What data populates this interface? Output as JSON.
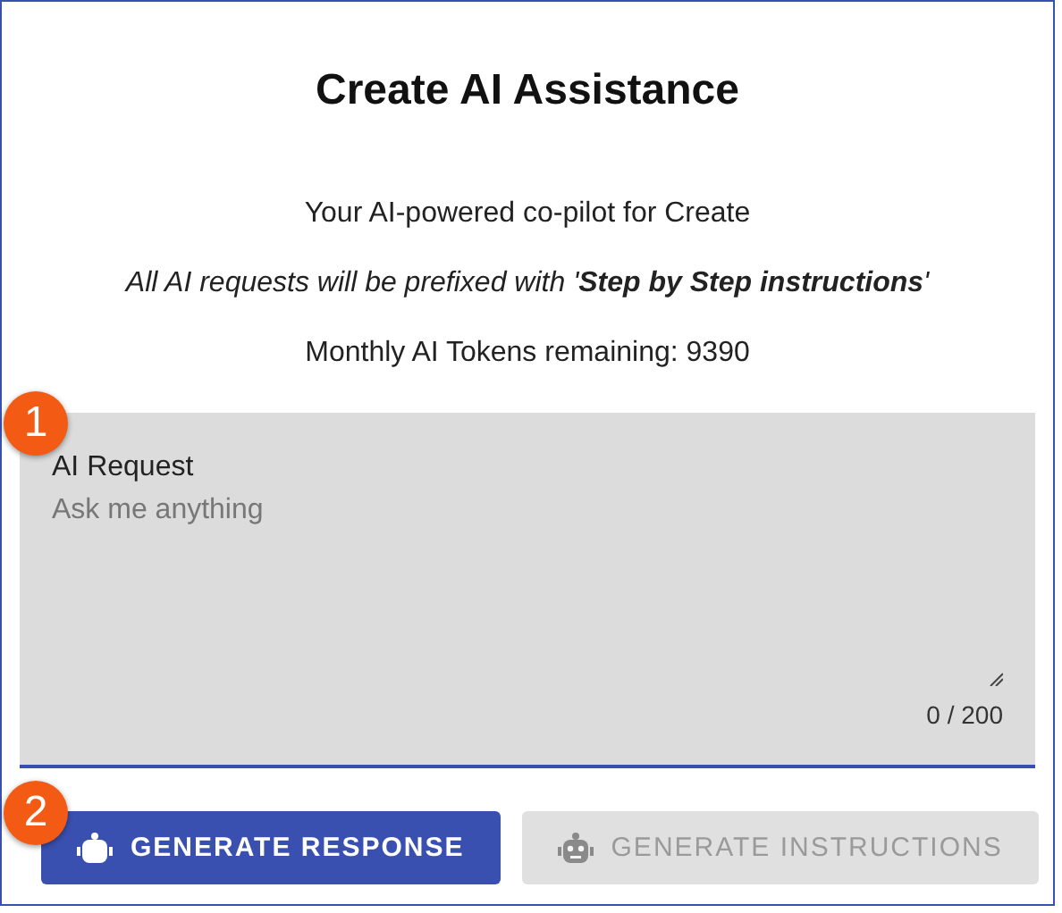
{
  "dialog": {
    "title": "Create AI Assistance",
    "subtitle": "Your AI-powered co-pilot for Create",
    "prefix_note": "All AI requests will be prefixed with '**Step by Step instructions**'",
    "tokens": "Monthly AI Tokens remaining: 9390"
  },
  "request_field": {
    "label": "AI Request",
    "placeholder": "Ask me anything",
    "counter": "0 / 200"
  },
  "buttons": [
    {
      "label": "GENERATE RESPONSE",
      "disabled": false
    },
    {
      "label": "GENERATE INSTRUCTIONS",
      "disabled": true
    }
  ],
  "callouts": [
    "1",
    "2"
  ]
}
